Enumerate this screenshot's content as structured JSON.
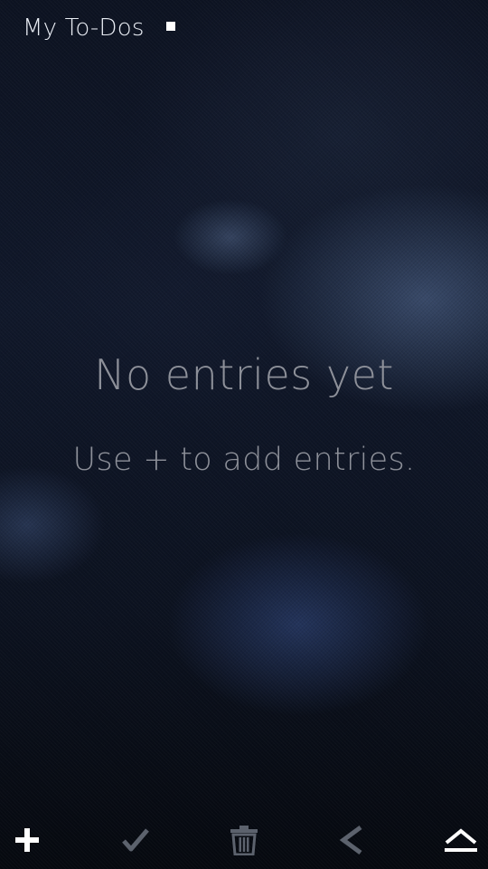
{
  "header": {
    "title": "My To-Dos"
  },
  "empty_state": {
    "title": "No entries yet",
    "hint": "Use + to add entries."
  },
  "toolbar": {
    "items": [
      {
        "icon": "plus-icon",
        "enabled": true
      },
      {
        "icon": "checkmark-icon",
        "enabled": false
      },
      {
        "icon": "trash-icon",
        "enabled": false
      },
      {
        "icon": "back-arrow-icon",
        "enabled": false
      },
      {
        "icon": "menu-eject-icon",
        "enabled": true
      }
    ]
  },
  "colors": {
    "text_primary": "#e9edf4",
    "text_muted": "#8d9099",
    "icon_active": "#ffffff",
    "icon_disabled": "#5c626d"
  }
}
